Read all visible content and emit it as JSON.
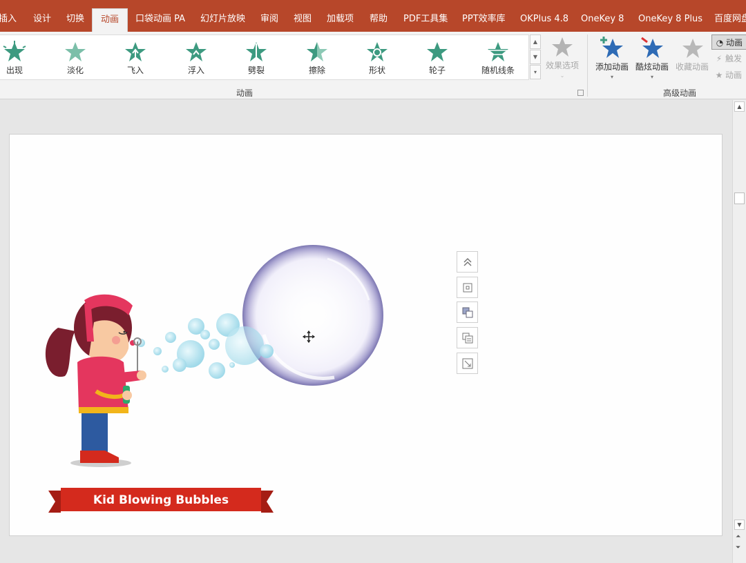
{
  "tabs": [
    {
      "label": "插入",
      "active": false
    },
    {
      "label": "设计",
      "active": false
    },
    {
      "label": "切换",
      "active": false
    },
    {
      "label": "动画",
      "active": true
    },
    {
      "label": "口袋动画 PA",
      "active": false
    },
    {
      "label": "幻灯片放映",
      "active": false
    },
    {
      "label": "审阅",
      "active": false
    },
    {
      "label": "视图",
      "active": false
    },
    {
      "label": "加载项",
      "active": false
    },
    {
      "label": "帮助",
      "active": false
    },
    {
      "label": "PDF工具集",
      "active": false
    },
    {
      "label": "PPT效率库",
      "active": false
    },
    {
      "label": "OKPlus 4.8",
      "active": false
    },
    {
      "label": "OneKey 8",
      "active": false
    },
    {
      "label": "OneKey 8 Plus",
      "active": false
    },
    {
      "label": "百度网盘",
      "active": false
    }
  ],
  "animation_gallery": [
    {
      "label": "出现",
      "icon": "star-burst-icon"
    },
    {
      "label": "淡化",
      "icon": "star-fade-icon"
    },
    {
      "label": "飞入",
      "icon": "star-fly-icon"
    },
    {
      "label": "浮入",
      "icon": "star-float-icon"
    },
    {
      "label": "劈裂",
      "icon": "star-split-icon"
    },
    {
      "label": "擦除",
      "icon": "star-wipe-icon"
    },
    {
      "label": "形状",
      "icon": "star-shape-icon"
    },
    {
      "label": "轮子",
      "icon": "star-wheel-icon"
    },
    {
      "label": "随机线条",
      "icon": "star-lines-icon"
    }
  ],
  "effect_options": {
    "label": "效果选项"
  },
  "animation_group_label": "动画",
  "advanced": {
    "group_label": "高级动画",
    "add_animation": "添加动画",
    "cool_animation": "酷炫动画",
    "favorite_animation": "收藏动画",
    "animation_pane": "动画",
    "trigger": "触发",
    "animation_painter": "动画"
  },
  "slide": {
    "banner_text": "Kid Blowing Bubbles"
  },
  "colors": {
    "accent": "#b7472a",
    "star_teal": "#3d9a80",
    "star_blue": "#2e6bb5",
    "banner_red": "#d42a1d",
    "bubble_blue": "#8fd3e6"
  }
}
